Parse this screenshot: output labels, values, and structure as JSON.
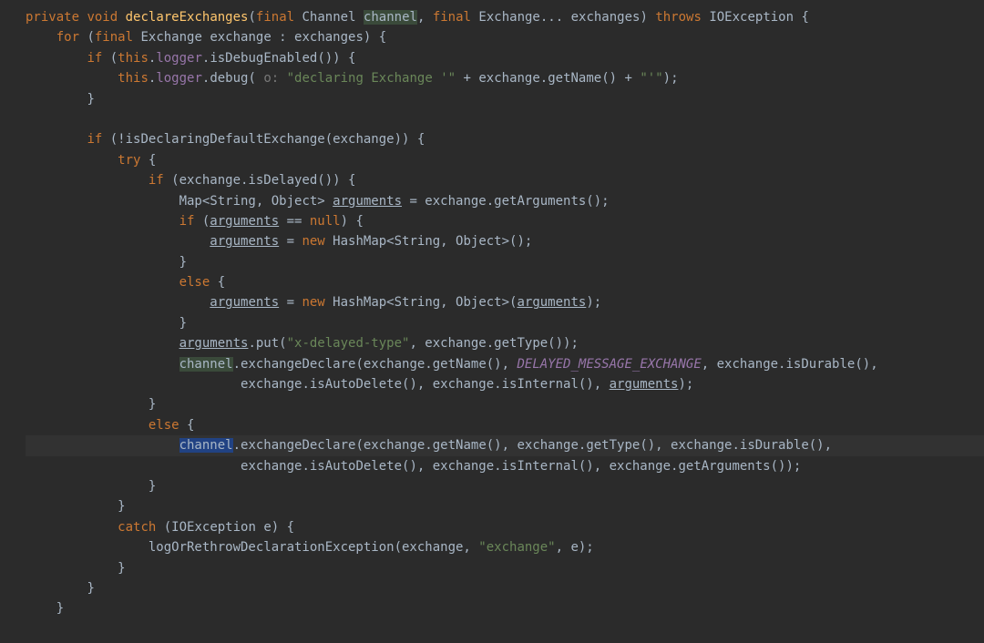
{
  "code": {
    "l1": {
      "kw1": "private",
      "kw2": "void",
      "method": "declareExchanges",
      "paren1": "(",
      "kw3": "final",
      "type1": "Channel",
      "param1": "channel",
      "comma1": ", ",
      "kw4": "final",
      "type2": "Exchange",
      "dots": "...",
      "param2": "exchanges",
      "paren2": ") ",
      "kw5": "throws",
      "exc": "IOException",
      "brace": " {"
    },
    "l2": {
      "indent": "    ",
      "kw1": "for",
      "paren1": " (",
      "kw2": "final",
      "type": " Exchange exchange : exchanges) {"
    },
    "l3": {
      "indent": "        ",
      "kw": "if",
      "rest": " (",
      "kw2": "this",
      "dot1": ".",
      "field": "logger",
      "rest2": ".isDebugEnabled()) {"
    },
    "l4": {
      "indent": "            ",
      "kw": "this",
      "dot": ".",
      "field": "logger",
      "dot2": ".debug( ",
      "hint": "o:",
      "sp": " ",
      "str": "\"declaring Exchange '\"",
      "plus": " + exchange.getName() + ",
      "str2": "\"'\"",
      "end": ");"
    },
    "l5": {
      "indent": "        ",
      "brace": "}"
    },
    "l6": " ",
    "l7": {
      "indent": "        ",
      "kw": "if",
      "rest": " (!isDeclaringDefaultExchange(exchange)) {"
    },
    "l8": {
      "indent": "            ",
      "kw": "try",
      "brace": " {"
    },
    "l9": {
      "indent": "                ",
      "kw": "if",
      "rest": " (exchange.isDelayed()) {"
    },
    "l10": {
      "indent": "                    ",
      "type": "Map<String, Object> ",
      "var": "arguments",
      "rest": " = exchange.getArguments();"
    },
    "l11": {
      "indent": "                    ",
      "kw": "if",
      "paren": " (",
      "var": "arguments",
      "rest": " == ",
      "kw2": "null",
      "end": ") {"
    },
    "l12": {
      "indent": "                        ",
      "var": "arguments",
      "rest": " = ",
      "kw": "new",
      "rest2": " HashMap<String, Object>();"
    },
    "l13": {
      "indent": "                    ",
      "brace": "}"
    },
    "l14": {
      "indent": "                    ",
      "kw": "else",
      "brace": " {"
    },
    "l15": {
      "indent": "                        ",
      "var": "arguments",
      "rest": " = ",
      "kw": "new",
      "rest2": " HashMap<String, Object>(",
      "var2": "arguments",
      "end": ");"
    },
    "l16": {
      "indent": "                    ",
      "brace": "}"
    },
    "l17": {
      "indent": "                    ",
      "var": "arguments",
      "rest": ".put(",
      "str": "\"x-delayed-type\"",
      "rest2": ", exchange.getType());"
    },
    "l18": {
      "indent": "                    ",
      "var": "channel",
      "rest": ".exchangeDeclare(exchange.getName(), ",
      "const": "DELAYED_MESSAGE_EXCHANGE",
      "rest2": ", exchange.isDurable(),"
    },
    "l19": {
      "indent": "                            ",
      "rest": "exchange.isAutoDelete(), exchange.isInternal(), ",
      "var": "arguments",
      "end": ");"
    },
    "l20": {
      "indent": "                ",
      "brace": "}"
    },
    "l21": {
      "indent": "                ",
      "kw": "else",
      "brace": " {"
    },
    "l22": {
      "indent": "                    ",
      "var": "channel",
      "rest": ".exchangeDeclare(exchange.getName(), exchange.getType(), exchange.isDurable(),"
    },
    "l23": {
      "indent": "                            ",
      "rest": "exchange.isAutoDelete(), exchange.isInternal(), exchange.getArguments());"
    },
    "l24": {
      "indent": "                ",
      "brace": "}"
    },
    "l25": {
      "indent": "            ",
      "brace": "}"
    },
    "l26": {
      "indent": "            ",
      "kw": "catch",
      "rest": " (IOException e) {"
    },
    "l27": {
      "indent": "                ",
      "rest": "logOrRethrowDeclarationException(exchange, ",
      "str": "\"exchange\"",
      "rest2": ", e);"
    },
    "l28": {
      "indent": "            ",
      "brace": "}"
    },
    "l29": {
      "indent": "        ",
      "brace": "}"
    },
    "l30": {
      "indent": "    ",
      "brace": "}"
    }
  }
}
